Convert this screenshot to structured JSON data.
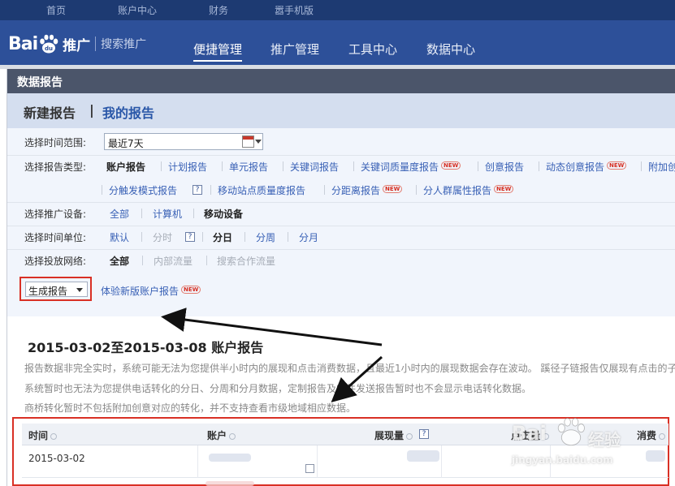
{
  "topnav": [
    "首页",
    "账户中心",
    "财务",
    "嚣手机版"
  ],
  "header": {
    "logo_text_a": "Bai",
    "logo_text_b": "推广",
    "logo_sub": "搜索推广",
    "nav": [
      "便捷管理",
      "推广管理",
      "工具中心",
      "数据中心"
    ],
    "active_nav": "便捷管理"
  },
  "panel": {
    "title": "数据报告",
    "tab_new": "新建报告",
    "tab_sep": "|",
    "tab_mine": "我的报告"
  },
  "form": {
    "time_range": {
      "label": "选择时间范围:",
      "value": "最近7天"
    },
    "report_type": {
      "label": "选择报告类型:",
      "row1": [
        {
          "text": "账户报告",
          "selected": true,
          "new": false
        },
        {
          "text": "计划报告",
          "selected": false,
          "new": false
        },
        {
          "text": "单元报告",
          "selected": false,
          "new": false
        },
        {
          "text": "关键词报告",
          "selected": false,
          "new": false
        },
        {
          "text": "关键词质量度报告",
          "selected": false,
          "new": true
        },
        {
          "text": "创意报告",
          "selected": false,
          "new": false
        },
        {
          "text": "动态创意报告",
          "selected": false,
          "new": true
        },
        {
          "text": "附加创",
          "selected": false,
          "new": false
        }
      ],
      "row2": [
        {
          "text": "分触发模式报告",
          "new": false,
          "help": true
        },
        {
          "text": "移动站点质量度报告",
          "new": false,
          "help": false
        },
        {
          "text": "分距离报告",
          "new": true,
          "help": false
        },
        {
          "text": "分人群属性报告",
          "new": true,
          "help": false
        }
      ]
    },
    "device": {
      "label": "选择推广设备:",
      "options": [
        "全部",
        "计算机",
        "移动设备"
      ],
      "selected": "移动设备"
    },
    "time_unit": {
      "label": "选择时间单位:",
      "options": [
        "默认",
        "分时",
        "分日",
        "分周",
        "分月"
      ],
      "selected": "分日",
      "disabled": [
        "分时"
      ]
    },
    "network": {
      "label": "选择投放网络:",
      "options": [
        "全部",
        "内部流量",
        "搜索合作流量"
      ],
      "selected": "全部",
      "disabled": [
        "内部流量",
        "搜索合作流量"
      ]
    },
    "generate": "生成报告",
    "try_new": "体验新版账户报告",
    "new_badge": "NEW",
    "help_glyph": "?"
  },
  "report": {
    "title": "2015-03-02至2015-03-08 账户报告",
    "notes": [
      "报告数据非完全实时，系统可能无法为您提供半小时内的展现和点击消费数据，且最近1小时内的展现数据会存在波动。 蹊径子链报告仅展现有点击的子",
      "系统暂时也无法为您提供电话转化的分日、分周和分月数据，定制报告及邮件发送报告暂时也不会显示电话转化数据。",
      "商桥转化暂时不包括附加创意对应的转化，并不支持查看市级地域相应数据。"
    ],
    "columns": [
      "时间",
      "账户",
      "展现量",
      "点击量",
      "消费"
    ],
    "rows": [
      {
        "date": "2015-03-02"
      }
    ]
  },
  "watermark": {
    "brand": "Bai",
    "brand2": "经验",
    "url": "jingyan.baidu.com"
  },
  "colors": {
    "accent": "#2d5099",
    "highlight": "#d93025",
    "link": "#3860b5"
  }
}
